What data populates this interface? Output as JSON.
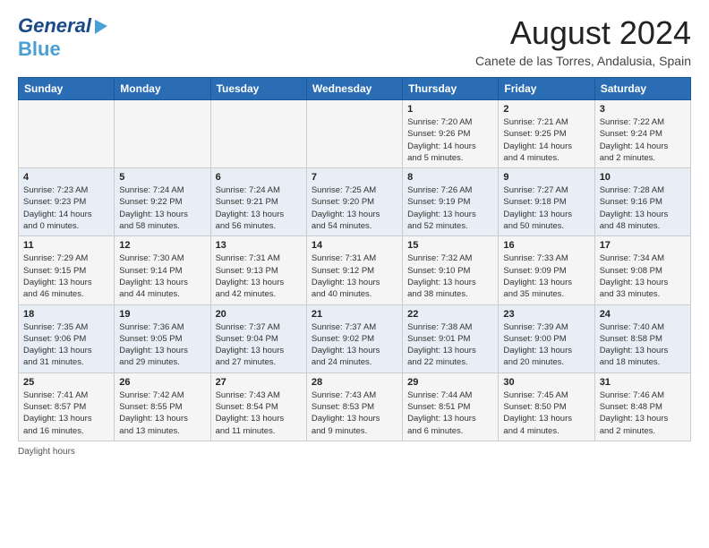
{
  "header": {
    "logo_line1": "General",
    "logo_line2": "Blue",
    "month_year": "August 2024",
    "location": "Canete de las Torres, Andalusia, Spain"
  },
  "days_of_week": [
    "Sunday",
    "Monday",
    "Tuesday",
    "Wednesday",
    "Thursday",
    "Friday",
    "Saturday"
  ],
  "weeks": [
    [
      {
        "day": "",
        "info": ""
      },
      {
        "day": "",
        "info": ""
      },
      {
        "day": "",
        "info": ""
      },
      {
        "day": "",
        "info": ""
      },
      {
        "day": "1",
        "info": "Sunrise: 7:20 AM\nSunset: 9:26 PM\nDaylight: 14 hours\nand 5 minutes."
      },
      {
        "day": "2",
        "info": "Sunrise: 7:21 AM\nSunset: 9:25 PM\nDaylight: 14 hours\nand 4 minutes."
      },
      {
        "day": "3",
        "info": "Sunrise: 7:22 AM\nSunset: 9:24 PM\nDaylight: 14 hours\nand 2 minutes."
      }
    ],
    [
      {
        "day": "4",
        "info": "Sunrise: 7:23 AM\nSunset: 9:23 PM\nDaylight: 14 hours\nand 0 minutes."
      },
      {
        "day": "5",
        "info": "Sunrise: 7:24 AM\nSunset: 9:22 PM\nDaylight: 13 hours\nand 58 minutes."
      },
      {
        "day": "6",
        "info": "Sunrise: 7:24 AM\nSunset: 9:21 PM\nDaylight: 13 hours\nand 56 minutes."
      },
      {
        "day": "7",
        "info": "Sunrise: 7:25 AM\nSunset: 9:20 PM\nDaylight: 13 hours\nand 54 minutes."
      },
      {
        "day": "8",
        "info": "Sunrise: 7:26 AM\nSunset: 9:19 PM\nDaylight: 13 hours\nand 52 minutes."
      },
      {
        "day": "9",
        "info": "Sunrise: 7:27 AM\nSunset: 9:18 PM\nDaylight: 13 hours\nand 50 minutes."
      },
      {
        "day": "10",
        "info": "Sunrise: 7:28 AM\nSunset: 9:16 PM\nDaylight: 13 hours\nand 48 minutes."
      }
    ],
    [
      {
        "day": "11",
        "info": "Sunrise: 7:29 AM\nSunset: 9:15 PM\nDaylight: 13 hours\nand 46 minutes."
      },
      {
        "day": "12",
        "info": "Sunrise: 7:30 AM\nSunset: 9:14 PM\nDaylight: 13 hours\nand 44 minutes."
      },
      {
        "day": "13",
        "info": "Sunrise: 7:31 AM\nSunset: 9:13 PM\nDaylight: 13 hours\nand 42 minutes."
      },
      {
        "day": "14",
        "info": "Sunrise: 7:31 AM\nSunset: 9:12 PM\nDaylight: 13 hours\nand 40 minutes."
      },
      {
        "day": "15",
        "info": "Sunrise: 7:32 AM\nSunset: 9:10 PM\nDaylight: 13 hours\nand 38 minutes."
      },
      {
        "day": "16",
        "info": "Sunrise: 7:33 AM\nSunset: 9:09 PM\nDaylight: 13 hours\nand 35 minutes."
      },
      {
        "day": "17",
        "info": "Sunrise: 7:34 AM\nSunset: 9:08 PM\nDaylight: 13 hours\nand 33 minutes."
      }
    ],
    [
      {
        "day": "18",
        "info": "Sunrise: 7:35 AM\nSunset: 9:06 PM\nDaylight: 13 hours\nand 31 minutes."
      },
      {
        "day": "19",
        "info": "Sunrise: 7:36 AM\nSunset: 9:05 PM\nDaylight: 13 hours\nand 29 minutes."
      },
      {
        "day": "20",
        "info": "Sunrise: 7:37 AM\nSunset: 9:04 PM\nDaylight: 13 hours\nand 27 minutes."
      },
      {
        "day": "21",
        "info": "Sunrise: 7:37 AM\nSunset: 9:02 PM\nDaylight: 13 hours\nand 24 minutes."
      },
      {
        "day": "22",
        "info": "Sunrise: 7:38 AM\nSunset: 9:01 PM\nDaylight: 13 hours\nand 22 minutes."
      },
      {
        "day": "23",
        "info": "Sunrise: 7:39 AM\nSunset: 9:00 PM\nDaylight: 13 hours\nand 20 minutes."
      },
      {
        "day": "24",
        "info": "Sunrise: 7:40 AM\nSunset: 8:58 PM\nDaylight: 13 hours\nand 18 minutes."
      }
    ],
    [
      {
        "day": "25",
        "info": "Sunrise: 7:41 AM\nSunset: 8:57 PM\nDaylight: 13 hours\nand 16 minutes."
      },
      {
        "day": "26",
        "info": "Sunrise: 7:42 AM\nSunset: 8:55 PM\nDaylight: 13 hours\nand 13 minutes."
      },
      {
        "day": "27",
        "info": "Sunrise: 7:43 AM\nSunset: 8:54 PM\nDaylight: 13 hours\nand 11 minutes."
      },
      {
        "day": "28",
        "info": "Sunrise: 7:43 AM\nSunset: 8:53 PM\nDaylight: 13 hours\nand 9 minutes."
      },
      {
        "day": "29",
        "info": "Sunrise: 7:44 AM\nSunset: 8:51 PM\nDaylight: 13 hours\nand 6 minutes."
      },
      {
        "day": "30",
        "info": "Sunrise: 7:45 AM\nSunset: 8:50 PM\nDaylight: 13 hours\nand 4 minutes."
      },
      {
        "day": "31",
        "info": "Sunrise: 7:46 AM\nSunset: 8:48 PM\nDaylight: 13 hours\nand 2 minutes."
      }
    ]
  ],
  "footer": {
    "daylight_label": "Daylight hours"
  }
}
